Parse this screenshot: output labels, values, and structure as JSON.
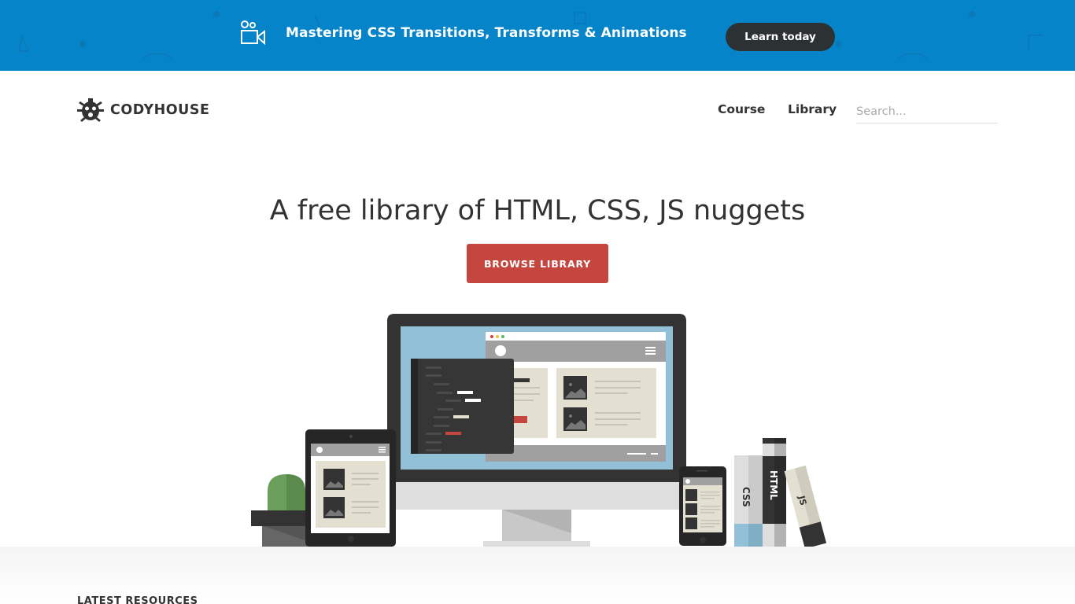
{
  "banner": {
    "icon": "video-camera-icon",
    "text": "Mastering CSS Transitions, Transforms & Animations",
    "button_label": "Learn today",
    "background_color": "#0684c9",
    "button_color": "#2c3133"
  },
  "header": {
    "logo_icon": "bug-icon",
    "logo_text": "CODYHOUSE",
    "nav": [
      {
        "label": "Course"
      },
      {
        "label": "Library"
      }
    ],
    "search": {
      "placeholder": "Search...",
      "value": ""
    }
  },
  "hero": {
    "title": "A free library of HTML, CSS, JS nuggets",
    "button_label": "BROWSE LIBRARY",
    "button_color": "#c5463e",
    "illustration": {
      "books": [
        "CSS",
        "HTML",
        "JS"
      ]
    }
  },
  "section": {
    "title": "LATEST RESOURCES"
  }
}
